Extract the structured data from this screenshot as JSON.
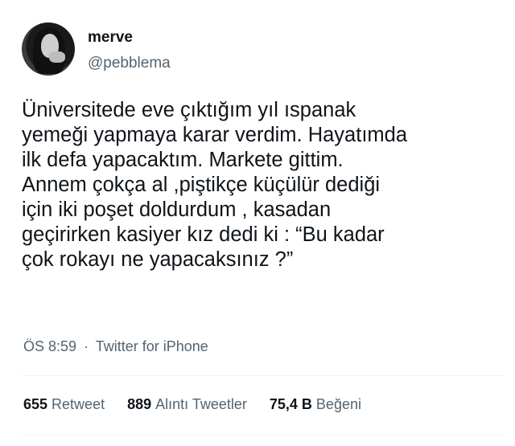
{
  "user": {
    "display_name": "merve",
    "handle": "@pebblema"
  },
  "tweet": {
    "text": "Üniversitede eve çıktığım yıl ıspanak\nyemeği yapmaya karar verdim. Hayatımda\nilk defa yapacaktım. Markete gittim.\nAnnem çokça al ,piştikçe küçülür dediği\niçin iki poşet doldurdum , kasadan\ngeçirirken kasiyer kız dedi ki : “Bu kadar\nçok rokayı ne yapacaksınız ?”",
    "time": "ÖS 8:59",
    "separator": "·",
    "source": "Twitter for iPhone"
  },
  "stats": [
    {
      "count": "655",
      "label": "Retweet"
    },
    {
      "count": "889",
      "label": "Alıntı Tweetler"
    },
    {
      "count": "75,4 B",
      "label": "Beğeni"
    }
  ]
}
